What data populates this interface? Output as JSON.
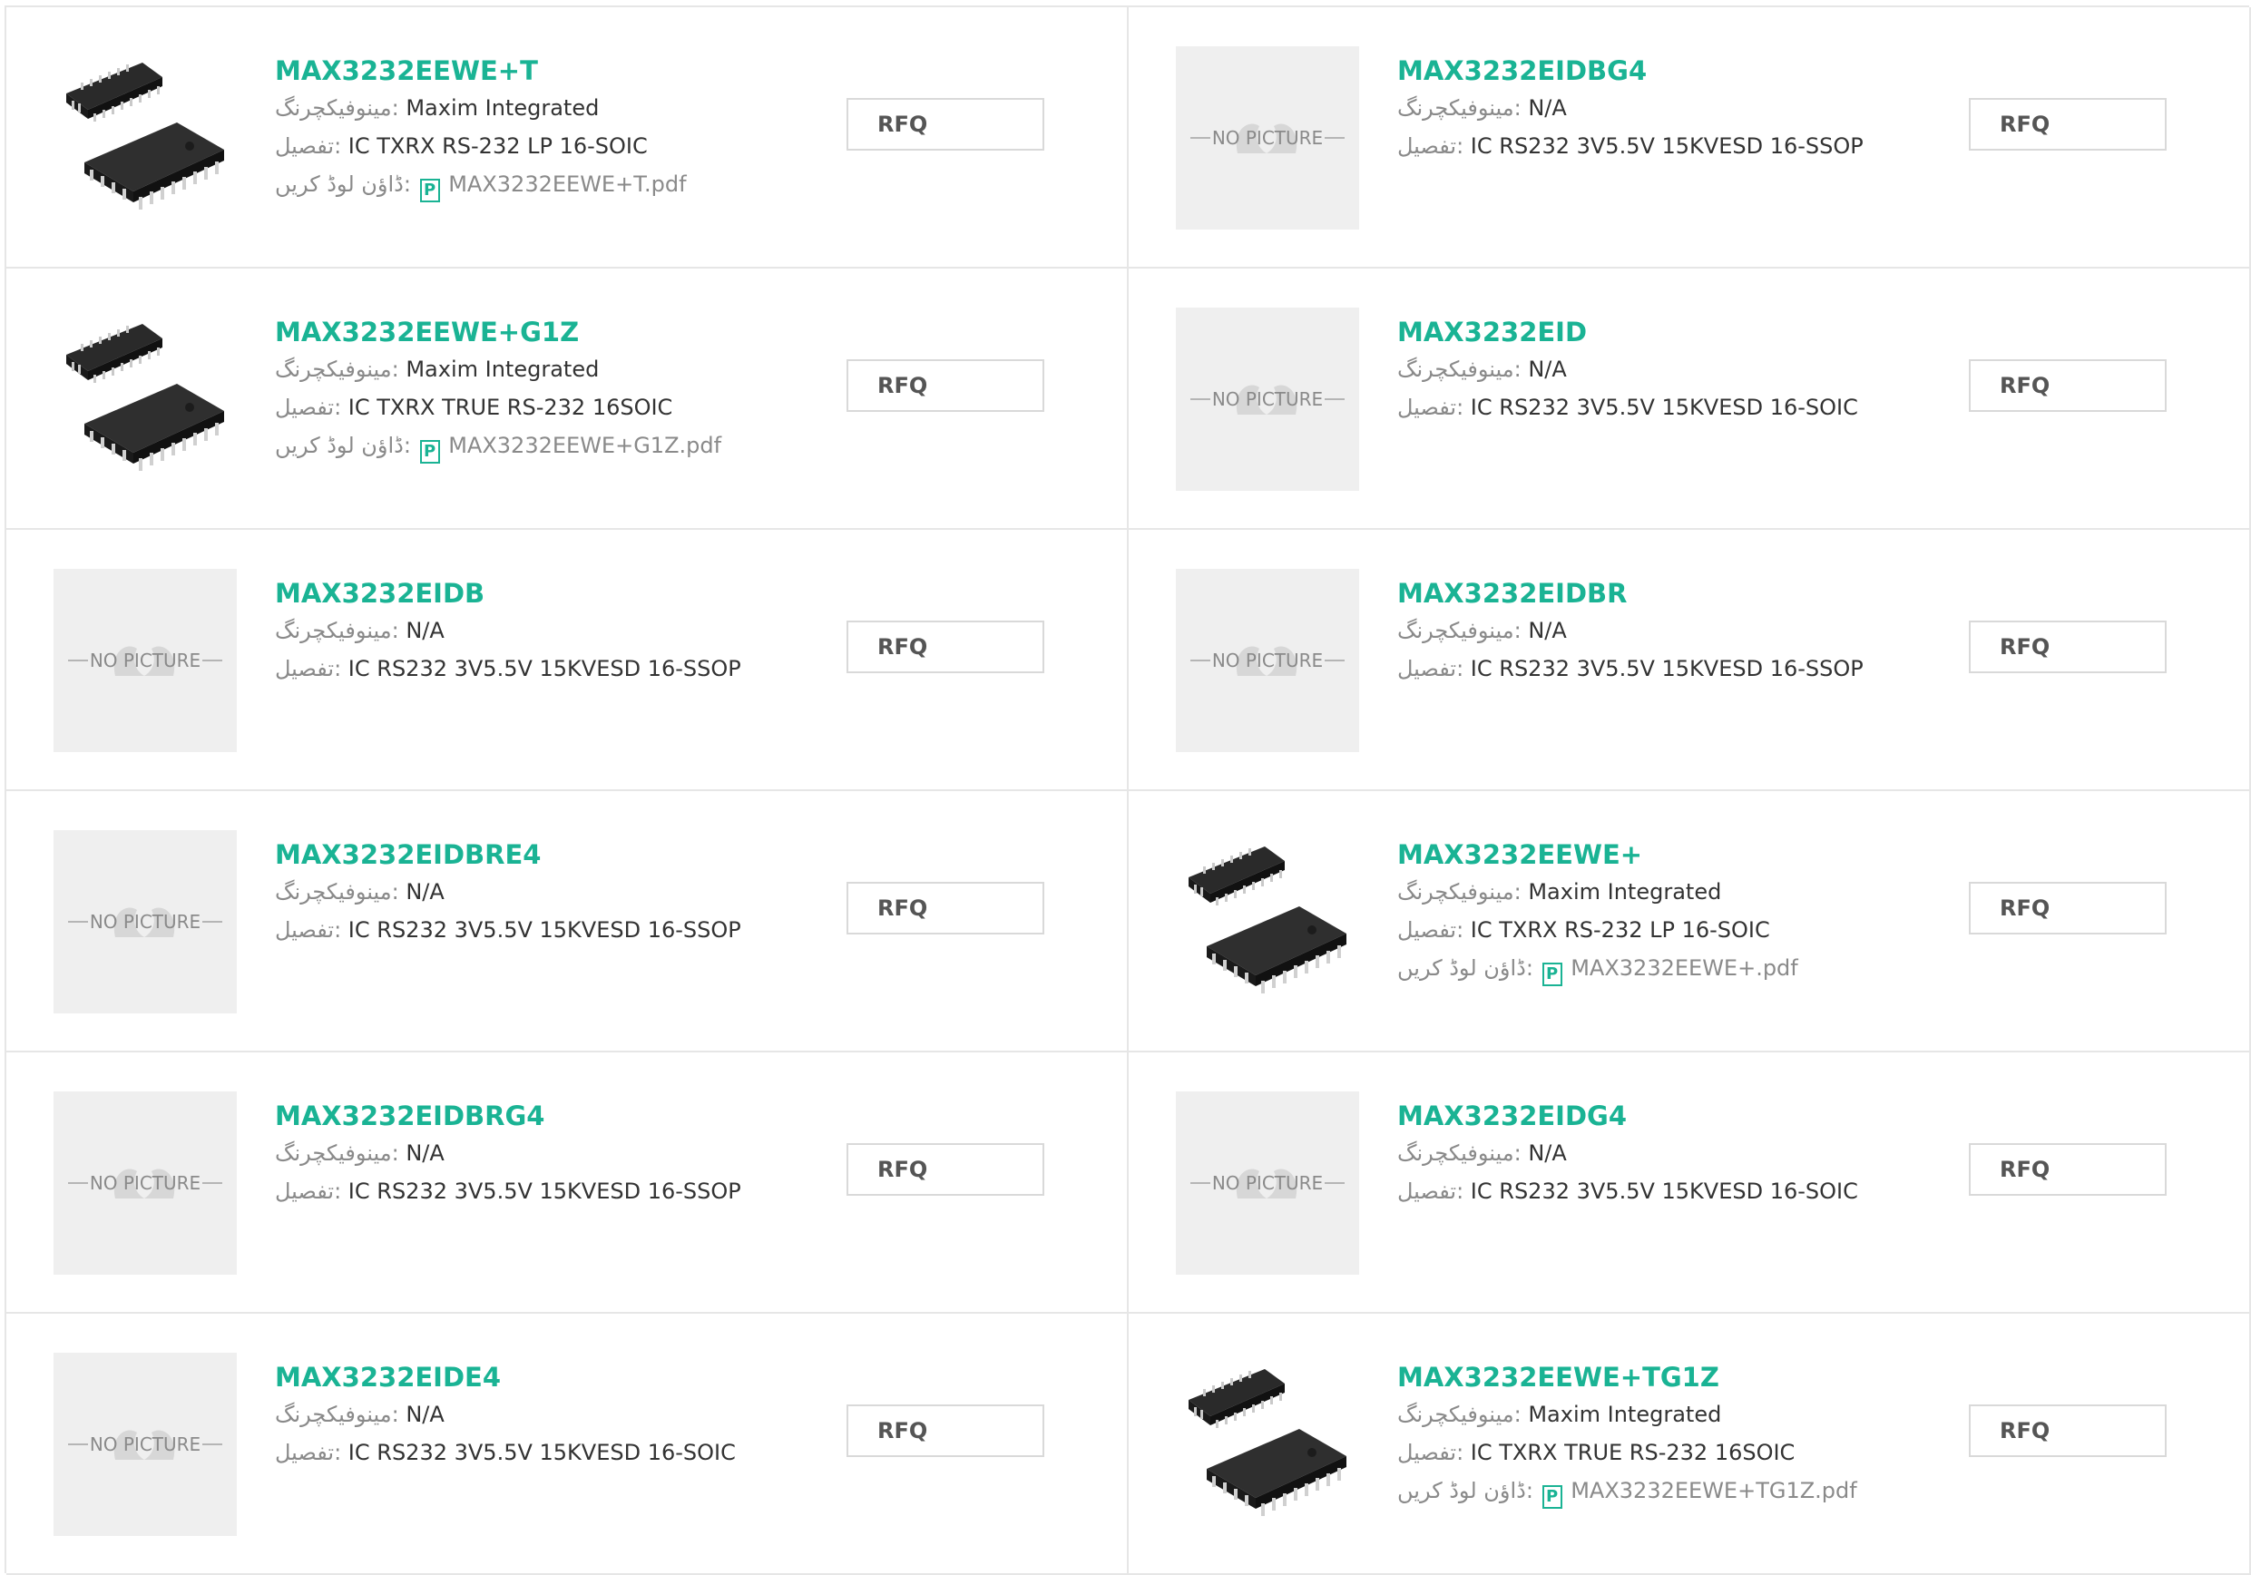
{
  "labels": {
    "manufacturer": "مینوفیکچرنگ:",
    "detail": "تفصیل:",
    "download": "ڈاؤن لوڈ کریں:",
    "rfq": "RFQ",
    "no_picture": "NO PICTURE",
    "pdf_icon": "P"
  },
  "products": [
    {
      "part": "MAX3232EEWE+T",
      "manufacturer": "Maxim Integrated",
      "description": "IC TXRX RS-232 LP 16-SOIC",
      "pdf": "MAX3232EEWE+T.pdf",
      "image": "chip-photo"
    },
    {
      "part": "MAX3232EIDBG4",
      "manufacturer": "N/A",
      "description": "IC RS232 3V5.5V 15KVESD 16-SSOP",
      "pdf": null,
      "image": "no-picture"
    },
    {
      "part": "MAX3232EEWE+G1Z",
      "manufacturer": "Maxim Integrated",
      "description": "IC TXRX TRUE RS-232 16SOIC",
      "pdf": "MAX3232EEWE+G1Z.pdf",
      "image": "chip-photo"
    },
    {
      "part": "MAX3232EID",
      "manufacturer": "N/A",
      "description": "IC RS232 3V5.5V 15KVESD 16-SOIC",
      "pdf": null,
      "image": "no-picture"
    },
    {
      "part": "MAX3232EIDB",
      "manufacturer": "N/A",
      "description": "IC RS232 3V5.5V 15KVESD 16-SSOP",
      "pdf": null,
      "image": "no-picture"
    },
    {
      "part": "MAX3232EIDBR",
      "manufacturer": "N/A",
      "description": "IC RS232 3V5.5V 15KVESD 16-SSOP",
      "pdf": null,
      "image": "no-picture"
    },
    {
      "part": "MAX3232EIDBRE4",
      "manufacturer": "N/A",
      "description": "IC RS232 3V5.5V 15KVESD 16-SSOP",
      "pdf": null,
      "image": "no-picture"
    },
    {
      "part": "MAX3232EEWE+",
      "manufacturer": "Maxim Integrated",
      "description": "IC TXRX RS-232 LP 16-SOIC",
      "pdf": "MAX3232EEWE+.pdf",
      "image": "chip-photo"
    },
    {
      "part": "MAX3232EIDBRG4",
      "manufacturer": "N/A",
      "description": "IC RS232 3V5.5V 15KVESD 16-SSOP",
      "pdf": null,
      "image": "no-picture"
    },
    {
      "part": "MAX3232EIDG4",
      "manufacturer": "N/A",
      "description": "IC RS232 3V5.5V 15KVESD 16-SOIC",
      "pdf": null,
      "image": "no-picture"
    },
    {
      "part": "MAX3232EIDE4",
      "manufacturer": "N/A",
      "description": "IC RS232 3V5.5V 15KVESD 16-SOIC",
      "pdf": null,
      "image": "no-picture"
    },
    {
      "part": "MAX3232EEWE+TG1Z",
      "manufacturer": "Maxim Integrated",
      "description": "IC TXRX TRUE RS-232 16SOIC",
      "pdf": "MAX3232EEWE+TG1Z.pdf",
      "image": "chip-photo"
    }
  ],
  "colors": {
    "accent": "#1ab394",
    "border": "#e6e6e6",
    "muted": "#8a8a8a",
    "placeholder_bg": "#efefef"
  }
}
